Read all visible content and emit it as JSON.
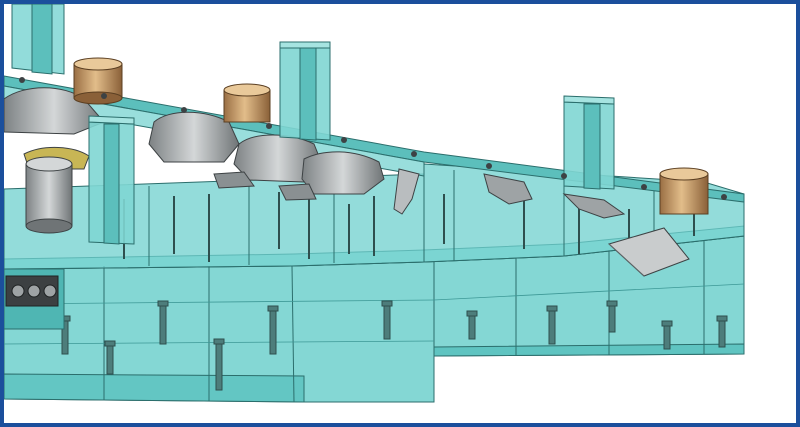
{
  "scene": {
    "subject": "",
    "colors": {
      "frame_border": "#1b4f9c",
      "background": "#ffffff",
      "die_fill": "#6fd0cd",
      "die_fill_light": "#9fe2df",
      "die_fill_dark": "#3fb1ae",
      "edge_line": "#2b6e6c",
      "bushing_outer": "#c9a06e",
      "bushing_inner": "#9a6f44",
      "part_grey": "#a9adb0",
      "part_dark": "#5e6466"
    }
  }
}
